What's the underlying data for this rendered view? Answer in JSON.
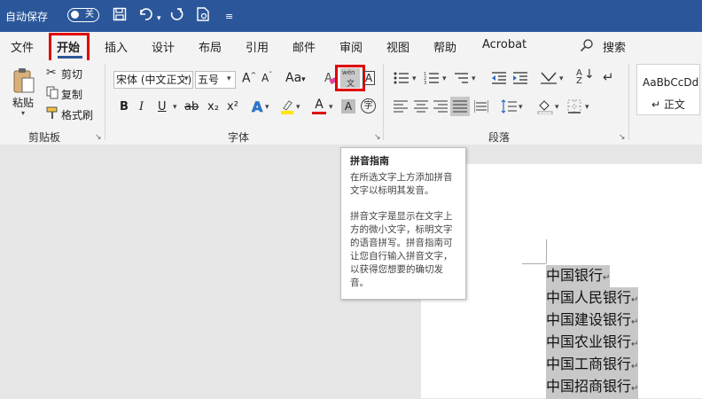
{
  "titlebar": {
    "autosave_label": "自动保存",
    "autosave_state": "关",
    "qat_icons": [
      "save-icon",
      "undo-icon",
      "redo-icon",
      "print-preview-icon",
      "customize-qat-icon"
    ]
  },
  "tabs": [
    "文件",
    "开始",
    "插入",
    "设计",
    "布局",
    "引用",
    "邮件",
    "审阅",
    "视图",
    "帮助",
    "Acrobat"
  ],
  "search": {
    "label": "搜索"
  },
  "clipboard": {
    "paste": "粘贴",
    "cut": "剪切",
    "copy": "复制",
    "format_painter": "格式刷",
    "group_label": "剪贴板"
  },
  "font": {
    "font_name": "宋体 (中文正文)",
    "font_size": "五号",
    "grow": "A",
    "shrink": "A",
    "change_case": "Aa",
    "phonetic_icon_text": "wén",
    "bold": "B",
    "italic": "I",
    "underline": "U",
    "strike": "ab",
    "subscript": "x₂",
    "superscript": "x²",
    "group_label": "字体"
  },
  "paragraph": {
    "group_label": "段落"
  },
  "styles": {
    "preview": "AaBbCcDd",
    "name": "↵ 正文"
  },
  "tooltip": {
    "title": "拼音指南",
    "para1": "在所选文字上方添加拼音文字以标明其发音。",
    "para2": "拼音文字是显示在文字上方的微小文字，标明文字的语音拼写。拼音指南可让您自行输入拼音文字，以获得您想要的确切发音。"
  },
  "document": {
    "lines": [
      "中国银行",
      "中国人民银行",
      "中国建设银行",
      "中国农业银行",
      "中国工商银行",
      "中国招商银行"
    ],
    "paragraph_mark": "↵"
  },
  "colors": {
    "title_bar": "#2b579a",
    "highlight_red": "#e00000"
  }
}
